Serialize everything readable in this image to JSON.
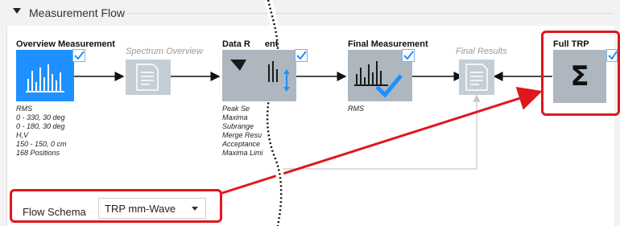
{
  "section": {
    "title": "Measurement Flow"
  },
  "nodes": {
    "overview": {
      "title": "Overview Measurement",
      "details": [
        "RMS",
        "0 - 330, 30 deg",
        "0 - 180, 30 deg",
        "H,V",
        "150 - 150, 0 cm",
        "168 Positions"
      ]
    },
    "spectrum": {
      "title": "Spectrum Overview"
    },
    "data_reduction": {
      "title": "Data R",
      "title_tail": "ent",
      "details": [
        "Peak Se",
        "Maxima",
        "Subrange",
        "Merge Resu",
        "Acceptance",
        "Maxima Limi"
      ]
    },
    "final_measurement": {
      "title": "Final Measurement",
      "details": [
        "RMS"
      ]
    },
    "final_results": {
      "title": "Final Results"
    },
    "full_trp": {
      "title": "Full TRP",
      "symbol": "Σ"
    }
  },
  "flow_schema": {
    "label": "Flow Schema",
    "value": "TRP mm-Wave"
  },
  "colors": {
    "accent_blue": "#1e90ff",
    "highlight_red": "#e0171d",
    "tile_gray": "#aeb7bf"
  },
  "icons": [
    "collapse-triangle-icon",
    "bar-chart-icon",
    "document-icon",
    "funnel-icon",
    "sort-arrows-icon",
    "checkmark-icon",
    "sigma-icon",
    "dropdown-arrow-icon"
  ]
}
